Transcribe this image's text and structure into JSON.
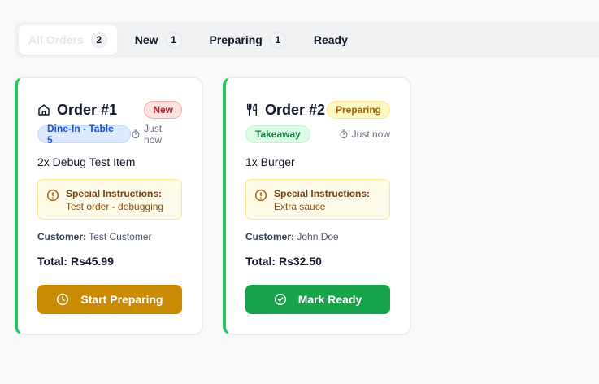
{
  "tabs": [
    {
      "label": "All Orders",
      "count": "2"
    },
    {
      "label": "New",
      "count": "1"
    },
    {
      "label": "Preparing",
      "count": "1"
    },
    {
      "label": "Ready"
    }
  ],
  "orders": [
    {
      "icon": "home-icon",
      "title": "Order #1",
      "status": "New",
      "type": "Dine-In - Table 5",
      "time": "Just now",
      "item": "2x Debug Test Item",
      "instructions_label": "Special Instructions:",
      "instructions": "Test order - debugging",
      "customer_label": "Customer:",
      "customer": "Test Customer",
      "total": "Total: Rs45.99",
      "action": "Start Preparing",
      "accent": "#22c55e",
      "button_color": "#ca8a04"
    },
    {
      "icon": "utensils-icon",
      "title": "Order #2",
      "status": "Preparing",
      "type": "Takeaway",
      "time": "Just now",
      "item": "1x Burger",
      "instructions_label": "Special Instructions:",
      "instructions": "Extra sauce",
      "customer_label": "Customer:",
      "customer": "John Doe",
      "total": "Total: Rs32.50",
      "action": "Mark Ready",
      "accent": "#22c55e",
      "button_color": "#16a34a"
    }
  ]
}
